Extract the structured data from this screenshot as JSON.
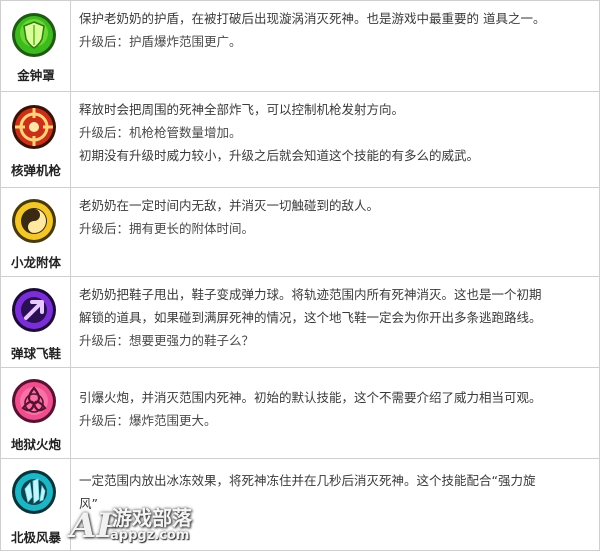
{
  "items": [
    {
      "name": "金钟罩",
      "icon": "green-shield-icon",
      "lines": [
        "保护老奶奶的护盾，在被打破后出现漩涡消灭死神。也是游戏中最重要的 道具之一。",
        "升级后：护盾爆炸范围更广。"
      ]
    },
    {
      "name": "核弹机枪",
      "icon": "red-crosshair-icon",
      "lines": [
        "释放时会把周围的死神全部炸飞，可以控制机枪发射方向。",
        "升级后：机枪枪管数量增加。",
        "初期没有升级时威力较小，升级之后就会知道这个技能的有多么的威武。"
      ]
    },
    {
      "name": "小龙附体",
      "icon": "yellow-swirl-icon",
      "lines": [
        "老奶奶在一定时间内无敌，并消灭一切触碰到的敌人。",
        "升级后：拥有更长的附体时间。"
      ]
    },
    {
      "name": "弹球飞鞋",
      "icon": "purple-arrow-icon",
      "lines": [
        "老奶奶把鞋子甩出，鞋子变成弹力球。将轨迹范围内所有死神消灭。这也是一个初期",
        "解锁的道具，如果碰到满屏死神的情况，这个地飞鞋一定会为你开出多条逃跑路线。",
        "升级后：想要更强力的鞋子么？"
      ]
    },
    {
      "name": "地狱火炮",
      "icon": "pink-triquetra-icon",
      "lines": [
        "引爆火炮，并消灭范围内死神。初始的默认技能，这个不需要介绍了威力相当可观。",
        "升级后：爆炸范围更大。"
      ]
    },
    {
      "name": "北极风暴",
      "icon": "ice-crystal-icon",
      "lines": [
        "一定范围内放出冰冻效果，将死神冻住并在几秒后消灭死神。这个技能配合“强力旋",
        "风”"
      ]
    }
  ],
  "watermark": {
    "logo": "AP",
    "title": "游戏部落",
    "url": "appgz.com"
  }
}
